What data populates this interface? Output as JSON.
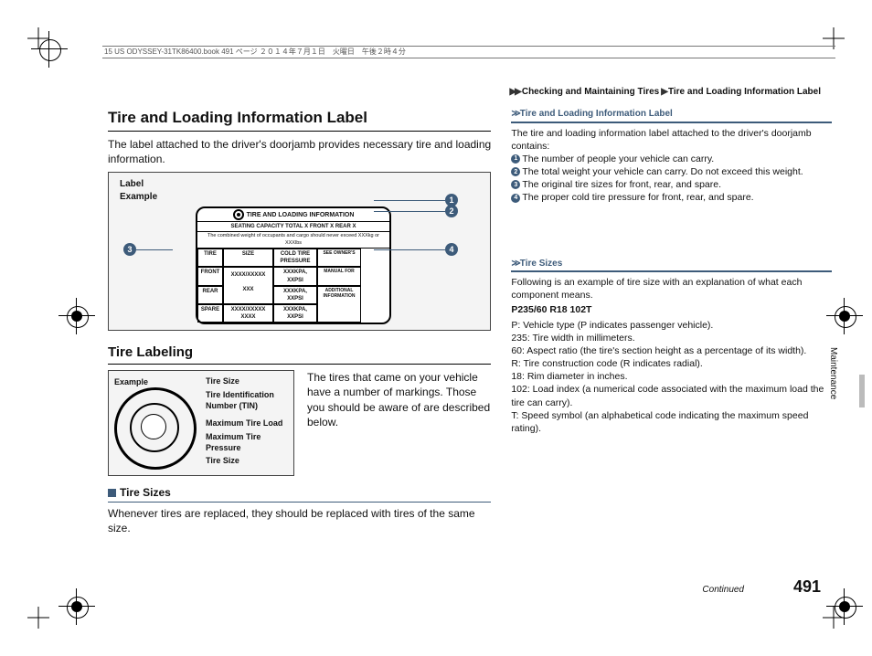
{
  "header": {
    "source": "15 US ODYSSEY-31TK86400.book  491 ページ  ２０１４年７月１日　火曜日　午後２時４分"
  },
  "breadcrumb": {
    "a": "Checking and Maintaining Tires",
    "b": "Tire and Loading Information Label"
  },
  "h1": "Tire and Loading Information Label",
  "intro": "The label attached to the driver's doorjamb provides necessary tire and loading information.",
  "labelExample": {
    "caption": "Label\nExample",
    "title": "TIRE  AND  LOADING  INFORMATION",
    "row2": "SEATING CAPACITY   TOTAL X   FRONT X   REAR X",
    "row3": "The combined weight of occupants and cargo should never exceed XXXkg or XXXlbs",
    "cols": [
      "TIRE",
      "SIZE",
      "COLD TIRE PRESSURE",
      ""
    ],
    "front": [
      "FRONT",
      "XXXX/XXXXX XXX",
      "XXXKPA, XXPSI",
      "SEE OWNER'S"
    ],
    "rear": [
      "REAR",
      "",
      "XXXKPA, XXPSI",
      "MANUAL FOR"
    ],
    "spare": [
      "SPARE",
      "XXXX/XXXXX XXXX",
      "XXXKPA, XXPSI",
      "ADDITIONAL INFORMATION"
    ]
  },
  "h2": "Tire Labeling",
  "tireDiag": {
    "caption": "Example",
    "labels": [
      "Tire Size",
      "Tire Identification Number (TIN)",
      "Maximum Tire Load",
      "Maximum Tire Pressure",
      "Tire Size"
    ]
  },
  "tireLabelingText": "The tires that came on your vehicle have a number of markings. Those you should be aware of are described below.",
  "tireSizesHead": "Tire Sizes",
  "tireSizesText": "Whenever tires are replaced, they should be replaced with tires of the same size.",
  "side1": {
    "title": "Tire and Loading Information Label",
    "intro": "The tire and loading information label attached to the driver's doorjamb contains:",
    "items": [
      "The number of people your vehicle can carry.",
      "The total weight your vehicle can carry. Do not exceed this weight.",
      "The original tire sizes for front, rear, and spare.",
      "The proper cold tire pressure for front, rear, and spare."
    ]
  },
  "side2": {
    "title": "Tire Sizes",
    "intro": "Following is an example of tire size with an explanation of what each component means.",
    "code": "P235/60 R18 102T",
    "lines": [
      "P: Vehicle type (P indicates passenger vehicle).",
      "235: Tire width in millimeters.",
      "60: Aspect ratio (the tire's section height as a percentage of its width).",
      "R: Tire construction code (R indicates radial).",
      "18: Rim diameter in inches.",
      "102: Load index (a numerical code associated with the maximum load the tire can carry).",
      "T: Speed symbol (an alphabetical code indicating the maximum speed rating)."
    ]
  },
  "vtab": "Maintenance",
  "continued": "Continued",
  "pageNum": "491"
}
